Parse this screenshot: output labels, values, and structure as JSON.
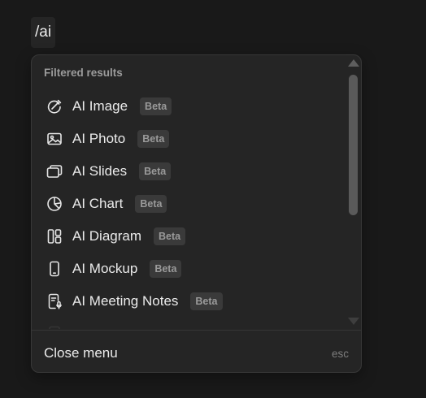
{
  "command": {
    "text": "/ai"
  },
  "menu": {
    "section_title": "Filtered results",
    "items": [
      {
        "icon": "ai-image-icon",
        "label": "AI Image",
        "badge": "Beta"
      },
      {
        "icon": "image-icon",
        "label": "AI Photo",
        "badge": "Beta"
      },
      {
        "icon": "slides-icon",
        "label": "AI Slides",
        "badge": "Beta"
      },
      {
        "icon": "pie-chart-icon",
        "label": "AI Chart",
        "badge": "Beta"
      },
      {
        "icon": "diagram-icon",
        "label": "AI Diagram",
        "badge": "Beta"
      },
      {
        "icon": "mobile-phone-icon",
        "label": "AI Mockup",
        "badge": "Beta"
      },
      {
        "icon": "meeting-notes-icon",
        "label": "AI Meeting Notes",
        "badge": "Beta"
      }
    ],
    "footer": {
      "label": "Close menu",
      "shortcut": "esc"
    }
  },
  "colors": {
    "background": "#191919",
    "menu_background": "#252525",
    "text": "#ebebeb",
    "muted_text": "#9b9b9b",
    "badge_background": "#3a3a3a"
  }
}
